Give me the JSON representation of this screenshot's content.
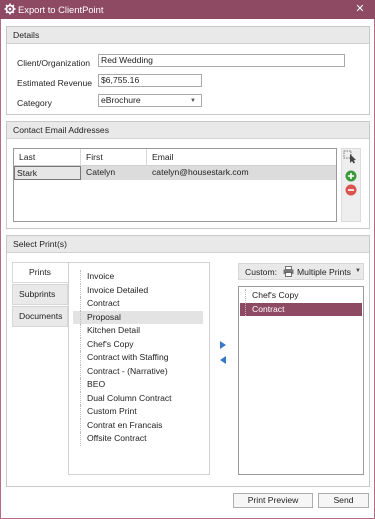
{
  "window": {
    "title": "Export to ClientPoint",
    "close_glyph": "✕"
  },
  "details": {
    "heading": "Details",
    "client_label": "Client/Organization",
    "client_value": "Red Wedding",
    "revenue_label": "Estimated Revenue",
    "revenue_value": "$6,755.16",
    "category_label": "Category",
    "category_value": "eBrochure"
  },
  "contacts": {
    "heading": "Contact Email Addresses",
    "columns": [
      "Last",
      "First",
      "Email"
    ],
    "rows": [
      {
        "last": "Stark",
        "first": "Catelyn",
        "email": "catelyn@housestark.com"
      }
    ]
  },
  "prints": {
    "heading": "Select Print(s)",
    "tabs": [
      "Prints",
      "Subprints",
      "Documents"
    ],
    "available": [
      "Invoice",
      "Invoice Detailed",
      "Contract",
      "Proposal",
      "Kitchen Detail",
      "Chef's Copy",
      "Contract with Staffing",
      "Contract - (Narrative)",
      "BEO",
      "Dual Column Contract",
      "Custom Print",
      "Contrat en Francais",
      "Offsite Contract"
    ],
    "available_selected": "Proposal",
    "custom_label": "Custom:",
    "multiple_prints_label": "Multiple Prints",
    "selected": [
      "Chef's Copy",
      "Contract"
    ],
    "selected_highlight": "Contract"
  },
  "footer": {
    "preview_label": "Print Preview",
    "send_label": "Send"
  },
  "colors": {
    "title_bar": "#8e4a63",
    "selection": "#8e4a63",
    "arrow": "#3a78c8",
    "add": "#3c9a3c",
    "remove": "#d9534f"
  }
}
